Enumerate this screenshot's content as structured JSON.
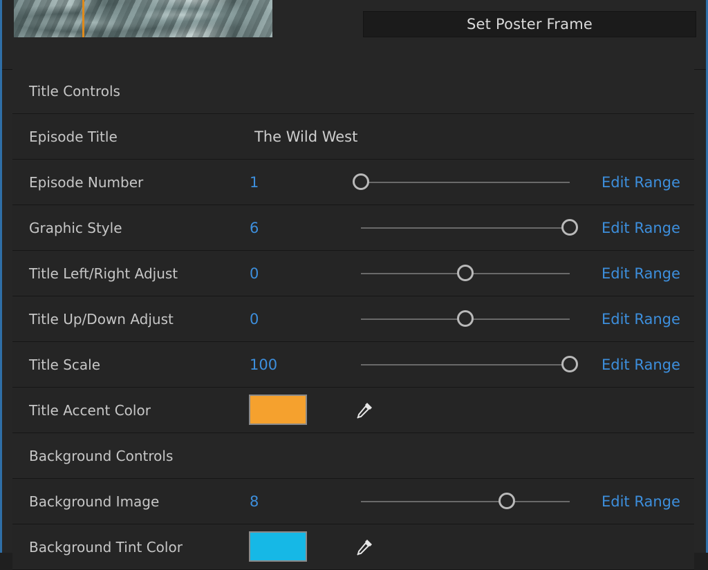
{
  "top": {
    "poster_button_label": "Set Poster Frame"
  },
  "sections": {
    "title_controls": "Title Controls",
    "background_controls": "Background Controls"
  },
  "edit_range_label": "Edit Range",
  "rows": {
    "episode_title": {
      "label": "Episode Title",
      "value": "The Wild West"
    },
    "episode_number": {
      "label": "Episode Number",
      "value": "1",
      "slider_position": 0.0
    },
    "graphic_style": {
      "label": "Graphic Style",
      "value": "6",
      "slider_position": 1.0
    },
    "title_lr_adjust": {
      "label": "Title Left/Right Adjust",
      "value": "0",
      "slider_position": 0.5
    },
    "title_ud_adjust": {
      "label": "Title Up/Down Adjust",
      "value": "0",
      "slider_position": 0.5
    },
    "title_scale": {
      "label": "Title Scale",
      "value": "100",
      "slider_position": 1.0
    },
    "title_accent_color": {
      "label": "Title Accent Color",
      "color": "#f5a12e"
    },
    "background_image": {
      "label": "Background Image",
      "value": "8",
      "slider_position": 0.7
    },
    "background_tint_color": {
      "label": "Background Tint Color",
      "color": "#16b8e6"
    }
  },
  "icons": {
    "eyedropper": "eyedropper-icon"
  },
  "colors": {
    "accent_blue": "#3d8fdd",
    "panel": "#252525"
  }
}
